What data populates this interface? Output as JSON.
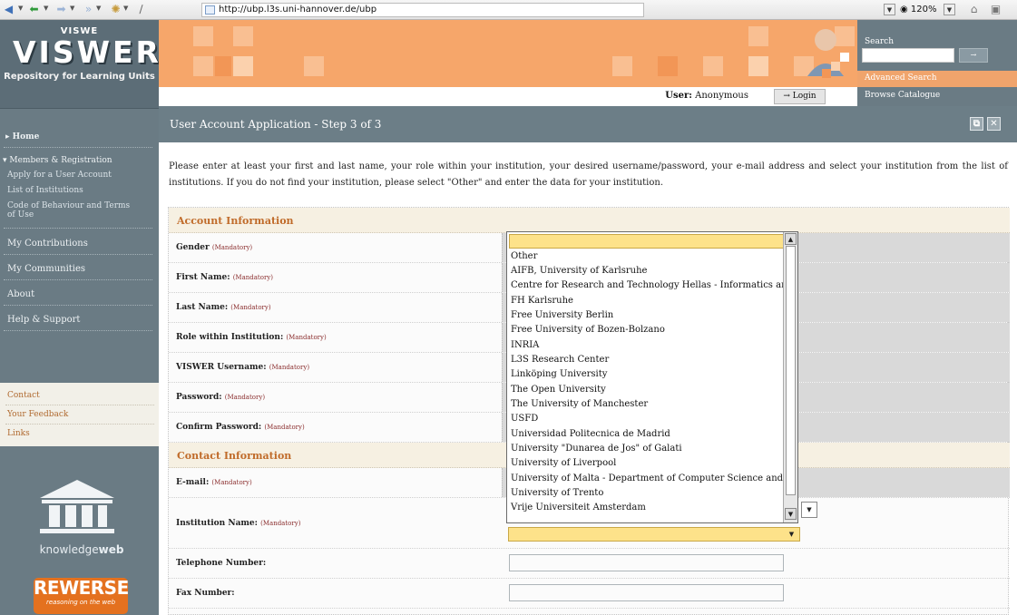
{
  "browser": {
    "url": "http://ubp.l3s.uni-hannover.de/ubp",
    "zoom": "120%"
  },
  "logo": {
    "top_text": "VISWE",
    "big_text": "VISWER",
    "tagline": "Repository for Learning Units"
  },
  "sidebar": {
    "home": "Home",
    "members": "Members & Registration",
    "sub_items": [
      "Apply for a User Account",
      "List of Institutions",
      "Code of Behaviour and Terms",
      "of Use"
    ],
    "items": [
      "My Contributions",
      "My Communities",
      "About",
      "Help & Support"
    ],
    "bottom_links": [
      "Contact",
      "Your Feedback",
      "Links"
    ],
    "knowledgeweb_prefix": "knowledge",
    "knowledgeweb_bold": "web",
    "rewerse": "REWERSE",
    "rewerse_sub": "reasoning on the web"
  },
  "search": {
    "label": "Search",
    "go": "→",
    "advanced": "Advanced Search",
    "browse": "Browse Catalogue"
  },
  "userbar": {
    "user_label": "User:",
    "user_name": "Anonymous",
    "login": "→ Login"
  },
  "page": {
    "title": "User Account Application - Step 3 of 3",
    "intro": "Please enter at least your first and last name, your role within your institution, your desired username/password, your e-mail address and select your institution from the list of institutions. If you do not find your institution, please select \"Other\" and enter the data for your institution."
  },
  "form": {
    "account_section": "Account Information",
    "contact_section": "Contact Information",
    "mandatory": "(Mandatory)",
    "fields": {
      "gender": "Gender",
      "first_name": "First Name:",
      "last_name": "Last Name:",
      "role": "Role within Institution:",
      "username": "VISWER Username:",
      "password": "Password:",
      "confirm_password": "Confirm Password:",
      "email": "E-mail:",
      "institution": "Institution Name:",
      "telephone": "Telephone Number:",
      "fax": "Fax Number:"
    }
  },
  "institution_dropdown": {
    "options": [
      "Other",
      "AIFB, University of Karlsruhe",
      "Centre for Research and Technology Hellas - Informatics and",
      "FH Karlsruhe",
      "Free University Berlin",
      "Free University of Bozen-Bolzano",
      "INRIA",
      "L3S Research Center",
      "Linköping University",
      "The Open University",
      "The University of Manchester",
      "USFD",
      "Universidad Politecnica de Madrid",
      "University \"Dunarea de Jos\" of Galati",
      "University of Liverpool",
      "University of Malta - Department of Computer Science and AI",
      "University of Trento",
      "Vrije Universiteit Amsterdam"
    ]
  },
  "colors": {
    "sidebar": "#6a7b84",
    "header_orange": "#f6a66a",
    "section_text": "#c06b2a",
    "dropdown_highlight": "#fde28a"
  }
}
